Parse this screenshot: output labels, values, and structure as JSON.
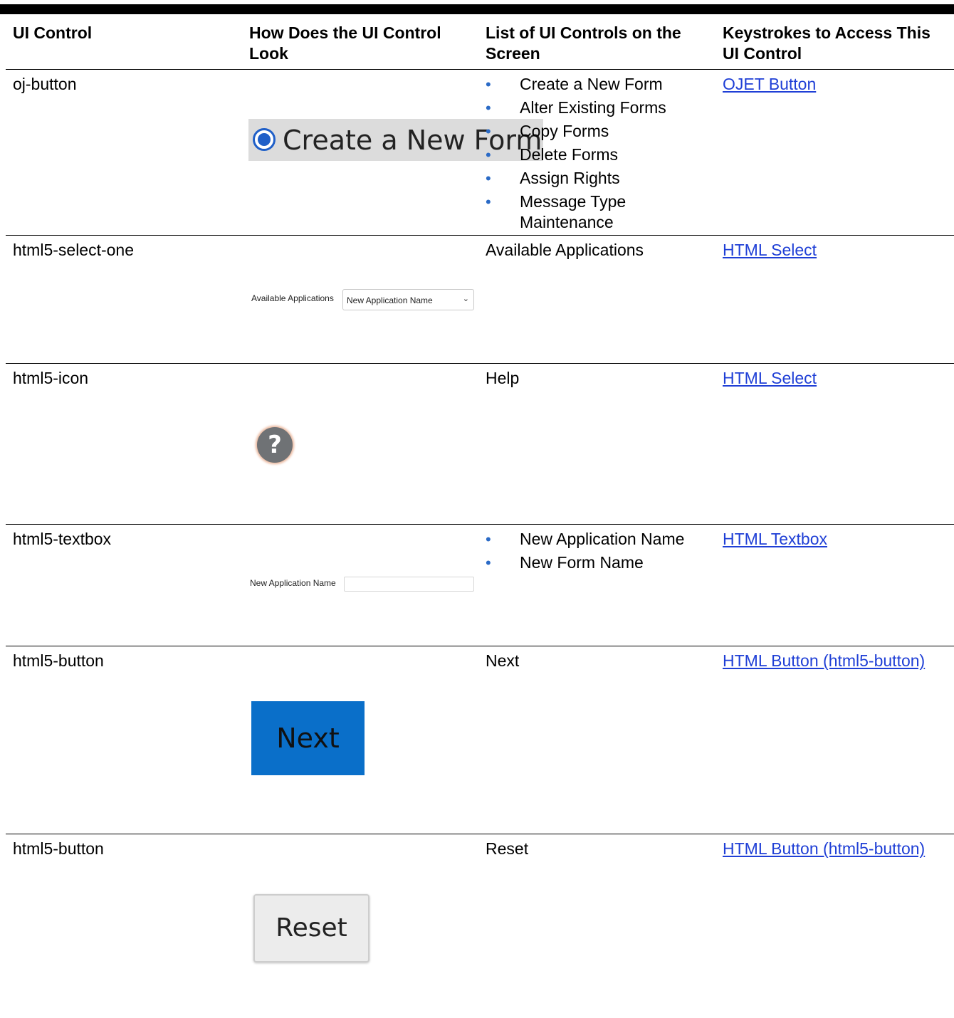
{
  "headers": {
    "col1": "UI Control",
    "col2": "How Does the UI Control Look",
    "col3": "List of UI Controls on the Screen",
    "col4": "Keystrokes to Access This UI Control"
  },
  "rows": [
    {
      "control": "oj-button",
      "controls_list": [
        "Create a New Form",
        "Alter Existing Forms",
        "Copy Forms",
        "Delete Forms",
        "Assign Rights",
        "Message Type Maintenance"
      ],
      "link": "OJET Button",
      "sample": {
        "radio_label": "Create a New Form",
        "radio_color": "#1f5fc8"
      }
    },
    {
      "control": "html5-select-one",
      "controls_list": [
        "Available Applications"
      ],
      "link": "HTML Select",
      "sample": {
        "label": "Available Applications",
        "selected": "New Application Name",
        "chevron_icon": "chevron-down-icon"
      }
    },
    {
      "control": "html5-icon",
      "controls_list": [
        "Help"
      ],
      "link": "HTML Select",
      "sample": {
        "icon": "help-icon",
        "glyph": "?"
      }
    },
    {
      "control": "html5-textbox",
      "controls_list": [
        "New Application Name",
        "New Form Name"
      ],
      "link": "HTML Textbox",
      "sample": {
        "label": "New Application Name",
        "value": ""
      }
    },
    {
      "control": "html5-button",
      "controls_list": [
        "Next"
      ],
      "link": "HTML Button (html5-button)",
      "sample": {
        "button_label": "Next",
        "button_color": "#0a6fc9"
      }
    },
    {
      "control": "html5-button",
      "controls_list": [
        "Reset"
      ],
      "link": "HTML Button (html5-button)",
      "sample": {
        "button_label": "Reset"
      }
    }
  ],
  "colors": {
    "link": "#1f3fd6",
    "bullet": "#2a6ac6"
  }
}
